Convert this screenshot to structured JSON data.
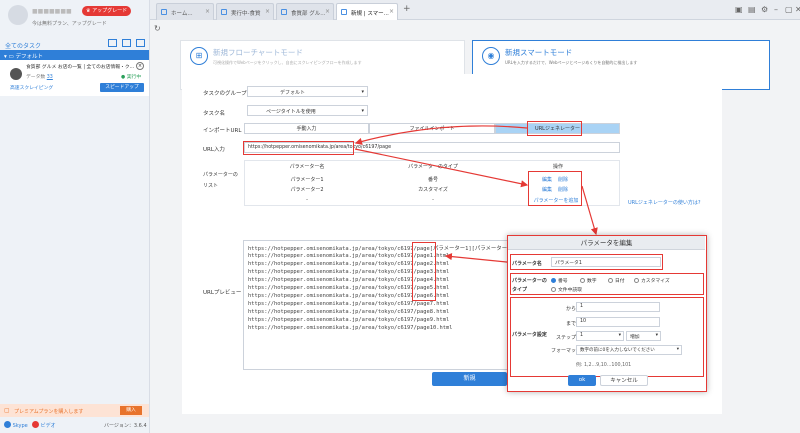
{
  "sidebar": {
    "user_name": "■■■■■■■",
    "upgrade_badge": "アップグレード",
    "plan_text": "今は無料プラン、アップグレード",
    "all_tasks": "全てのタスク",
    "default_group": "デフォルト",
    "task_name": "食質部 グルメ お店の一覧 | 全てのお店情報・ク...",
    "task_data_label": "データ数",
    "task_data_count": "33",
    "task_status": "実行中",
    "task_speed_label": "高速スクレイピング",
    "speedup_button": "スピードアップ",
    "premium_text": "プレミアムプランを購入します",
    "buy_button": "購入",
    "skype": "Skype",
    "bilibili": "ビデオ",
    "version": "バージョン：3.6.4"
  },
  "tabs": [
    {
      "label": "ホーム..."
    },
    {
      "label": "実行中-食質"
    },
    {
      "label": "食質部 グル..."
    },
    {
      "label": "新規 | スマー..."
    }
  ],
  "modes": {
    "flow_title": "新規フローチャートモード",
    "flow_desc": "可視化操作でWebページをクリックし、自由にスクレイピングフローを作成します",
    "smart_title": "新規スマートモード",
    "smart_desc": "URLを入力するだけで、Webページとページめくりを自動的に検出します"
  },
  "form": {
    "group_label": "タスクのグループ",
    "group_value": "デフォルト",
    "name_label": "タスク名",
    "name_value": "ページタイトルを使用",
    "import_label": "インポートURL",
    "import_options": [
      "手動入力",
      "ファイルインポート",
      "URLジェネレーター"
    ],
    "url_label": "URL入力",
    "url_value": "https://hotpepper.omisenomikata.jp/area/tokyo/c6197/page",
    "params_label": "パラメーターのリスト",
    "table_headers": [
      "パラメーター名",
      "パラメーターのタイプ",
      "操作"
    ],
    "rows": [
      {
        "name": "パラメーター1",
        "type": "番号",
        "edit": "編集",
        "delete": "削除"
      },
      {
        "name": "パラメーター2",
        "type": "カスタマイズ",
        "edit": "編集",
        "delete": "削除"
      },
      {
        "name": "-",
        "type": "-",
        "edit": "",
        "delete": ""
      }
    ],
    "add_param": "パラメーターを追加",
    "generator_help": "URLジェネレーターの使い方は?",
    "preview_label": "URLプレビュー",
    "preview_lines": [
      "https://hotpepper.omisenomikata.jp/area/tokyo/c6197/page[パラメーター1][パラメーター2]",
      "https://hotpepper.omisenomikata.jp/area/tokyo/c6197/page1.html",
      "https://hotpepper.omisenomikata.jp/area/tokyo/c6197/page2.html",
      "https://hotpepper.omisenomikata.jp/area/tokyo/c6197/page3.html",
      "https://hotpepper.omisenomikata.jp/area/tokyo/c6197/page4.html",
      "https://hotpepper.omisenomikata.jp/area/tokyo/c6197/page5.html",
      "https://hotpepper.omisenomikata.jp/area/tokyo/c6197/page6.html",
      "https://hotpepper.omisenomikata.jp/area/tokyo/c6197/page7.html",
      "https://hotpepper.omisenomikata.jp/area/tokyo/c6197/page8.html",
      "https://hotpepper.omisenomikata.jp/area/tokyo/c6197/page9.html",
      "https://hotpepper.omisenomikata.jp/area/tokyo/c6197/page10.html"
    ],
    "submit": "新規"
  },
  "dialog": {
    "title": "パラメータを編集",
    "name_label": "パラメータ名",
    "name_value": "パラメータ1",
    "type_label": "パラメーターのタイプ",
    "type_options": [
      "番号",
      "数字",
      "日付",
      "カスタマイズ",
      "文件中読取"
    ],
    "settings_label": "パラメータ設定",
    "from_label": "から",
    "from_value": "1",
    "to_label": "まで",
    "to_value": "10",
    "step_label": "ステップ",
    "step_value": "1",
    "step_mode": "増加",
    "format_label": "フォーマット",
    "format_value": "数字の前に0を入力しないでください",
    "example": "例: 1,2...9,10...100,101",
    "ok": "ok",
    "cancel": "キャンセル"
  }
}
